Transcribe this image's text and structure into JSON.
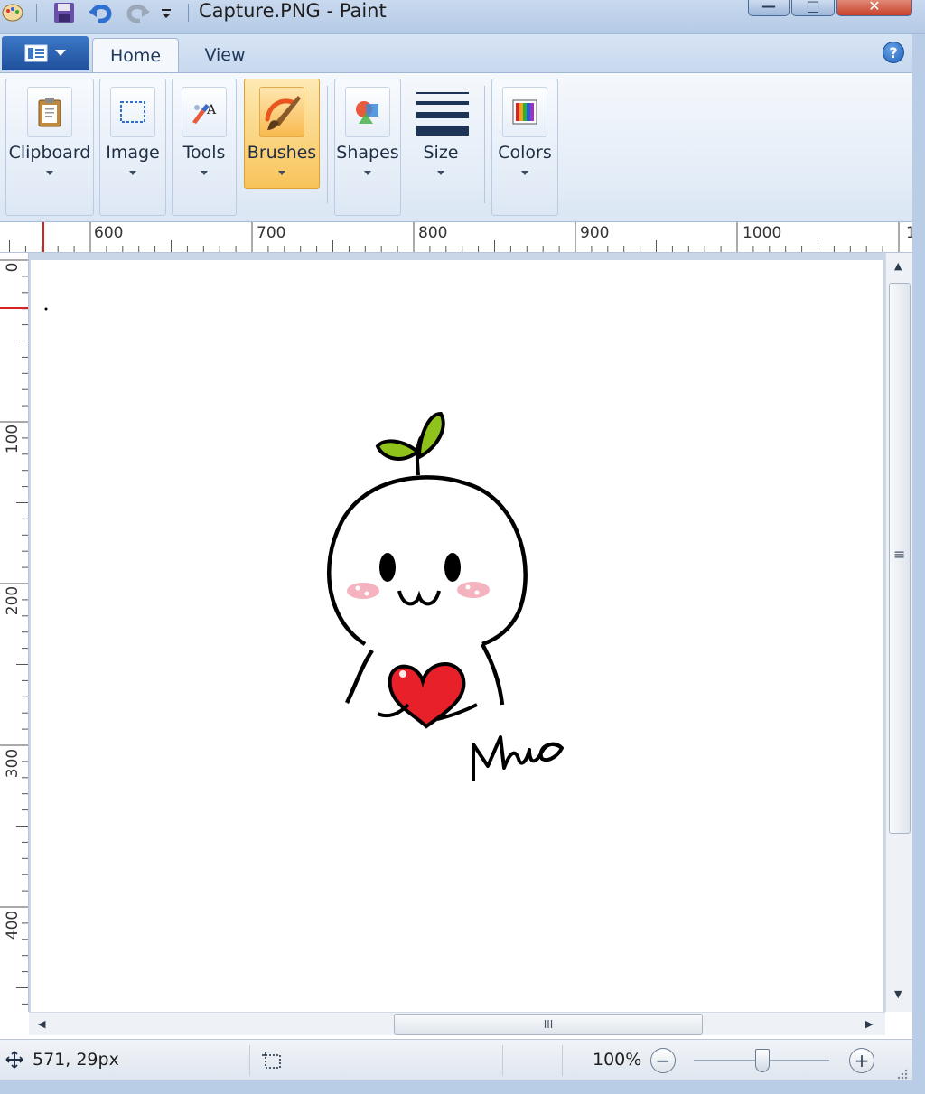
{
  "titlebar": {
    "title": "Capture.PNG - Paint",
    "minimize_label": "—",
    "maximize_label": "□",
    "close_label": "✕"
  },
  "tabs": [
    {
      "label": "Home",
      "active": true
    },
    {
      "label": "View",
      "active": false
    }
  ],
  "help_label": "?",
  "ribbon": {
    "groups": [
      {
        "label": "Clipboard",
        "icon": "clipboard-icon"
      },
      {
        "label": "Image",
        "icon": "select-icon"
      },
      {
        "label": "Tools",
        "icon": "tools-icon"
      },
      {
        "label": "Brushes",
        "icon": "brush-icon",
        "selected": true
      },
      {
        "label": "Shapes",
        "icon": "shapes-icon"
      },
      {
        "label": "Size",
        "icon": "size-icon"
      },
      {
        "label": "Colors",
        "icon": "colors-icon"
      }
    ]
  },
  "ruler": {
    "h_labels": [
      "600",
      "700",
      "800",
      "900",
      "1000",
      "1"
    ],
    "v_labels": [
      "0",
      "100",
      "200",
      "300",
      "400"
    ]
  },
  "drawing": {
    "signature": "Mua",
    "colors": {
      "leaf": "#8fc21b",
      "heart": "#e8202a",
      "blush": "#f5b3c0",
      "outline": "#000000"
    }
  },
  "status": {
    "position": "571, 29px",
    "zoom": "100%",
    "zoom_minus": "−",
    "zoom_plus": "+"
  },
  "scrollbar": {
    "grip": "III",
    "v_grip": "≡"
  },
  "arrows": {
    "up": "▲",
    "down": "▼",
    "left": "◀",
    "right": "▶"
  }
}
